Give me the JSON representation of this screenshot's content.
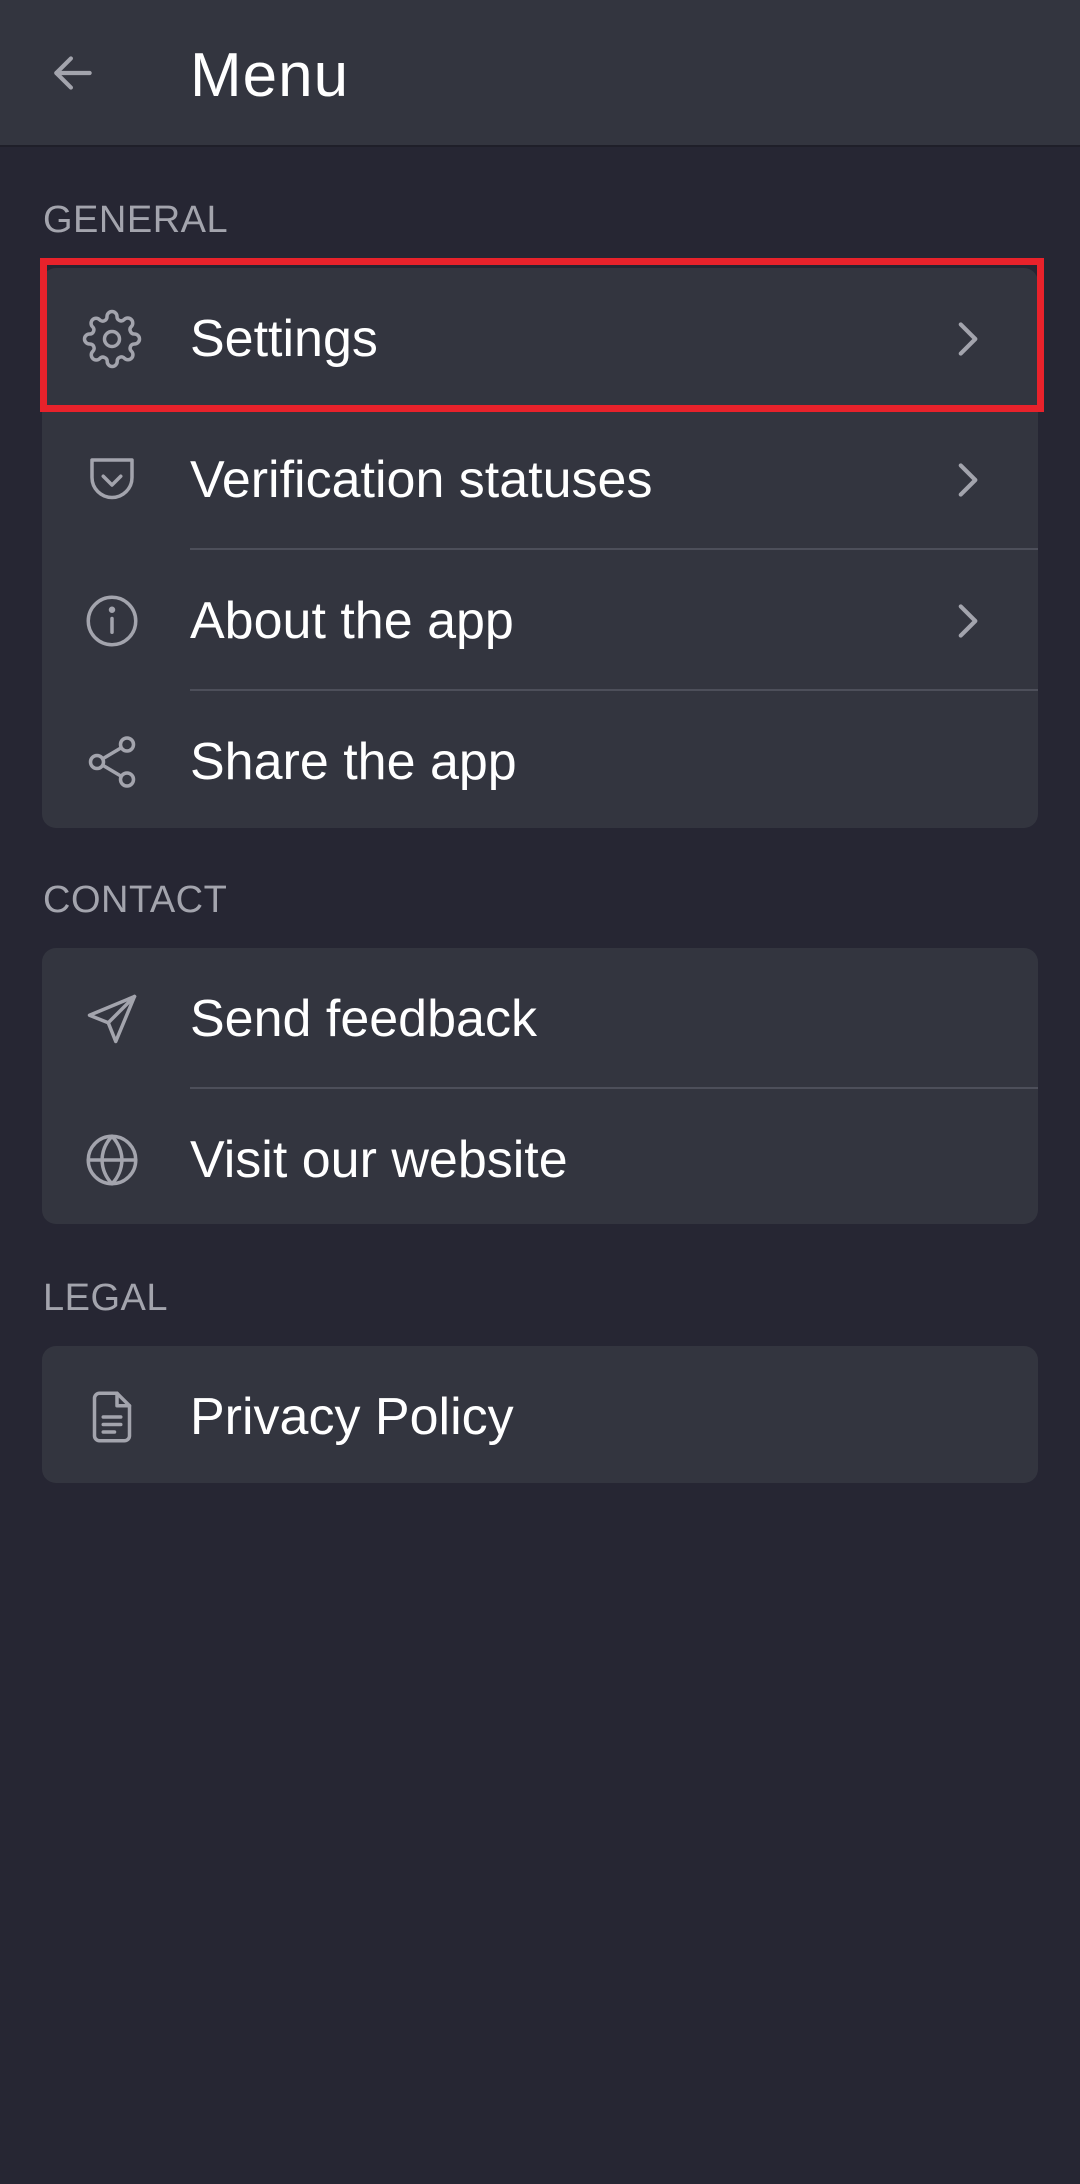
{
  "app_bar": {
    "title": "Menu",
    "back_icon": "arrow-left-icon"
  },
  "sections": {
    "general": {
      "header": "GENERAL",
      "items": [
        {
          "label": "Settings",
          "icon": "gear-icon",
          "has_chevron": true
        },
        {
          "label": "Verification statuses",
          "icon": "shield-check-icon",
          "has_chevron": true
        },
        {
          "label": "About the app",
          "icon": "info-icon",
          "has_chevron": true
        },
        {
          "label": "Share the app",
          "icon": "share-icon",
          "has_chevron": false
        }
      ]
    },
    "contact": {
      "header": "CONTACT",
      "items": [
        {
          "label": "Send feedback",
          "icon": "send-icon",
          "has_chevron": false
        },
        {
          "label": "Visit our website",
          "icon": "globe-icon",
          "has_chevron": false
        }
      ]
    },
    "legal": {
      "header": "LEGAL",
      "items": [
        {
          "label": "Privacy Policy",
          "icon": "document-icon",
          "has_chevron": false
        }
      ]
    }
  },
  "colors": {
    "background": "#262633",
    "surface": "#33353f",
    "icon": "#a3a4ad",
    "section_header": "#a3a4ad",
    "highlight": "#e8222b"
  }
}
